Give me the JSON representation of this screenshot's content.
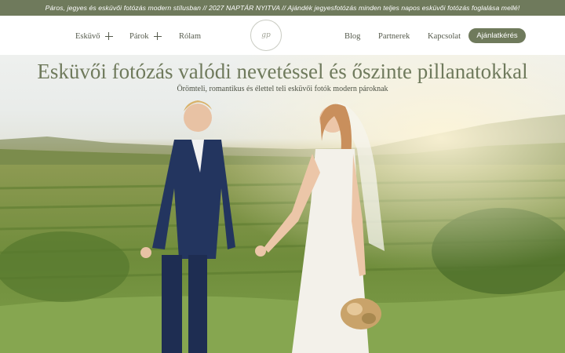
{
  "announcement": {
    "text": "Páros, jegyes és esküvői fotózás modern stílusban // 2027 NAPTÁR NYITVA // Ajándék jegyesfotózás minden teljes napos esküvői fotózás foglalása mellé!"
  },
  "nav": {
    "left": [
      {
        "label": "Esküvő",
        "icon": "plus-icon"
      },
      {
        "label": "Párok",
        "icon": "plus-icon"
      },
      {
        "label": "Rólam"
      }
    ],
    "right": [
      {
        "label": "Blog"
      },
      {
        "label": "Partnerek"
      },
      {
        "label": "Kapcsolat"
      }
    ],
    "cta_label": "Ajánlatkérés",
    "logo_mark": "gp"
  },
  "hero": {
    "title": "Esküvői fotózás valódi nevetéssel és őszinte pillanatokkal",
    "subtitle": "Örömteli, romantikus és élettel teli esküvői fotók modern pároknak",
    "image": "couple-holding-hands-in-vineyard-photo"
  },
  "colors": {
    "brand": "#6f7a5c",
    "topbar_text": "#ffffff",
    "nav_text": "#555a4c"
  }
}
